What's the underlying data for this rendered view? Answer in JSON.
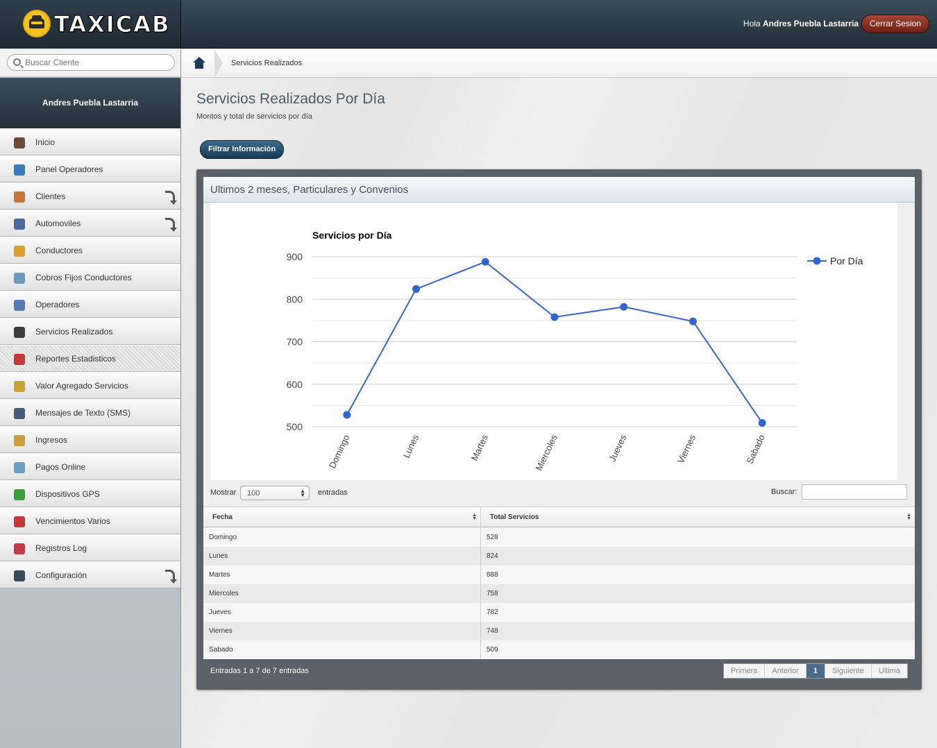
{
  "header": {
    "logo_text": "TAXICAB",
    "greeting_prefix": "Hola",
    "user_name": "Andres Puebla Lastarria",
    "logout_label": "Cerrar Sesion"
  },
  "sidebar": {
    "search_placeholder": "Buscar Cliente",
    "user_name": "Andres Puebla Lastarria",
    "items": [
      {
        "label": "Inicio",
        "icon": "speedometer-icon",
        "color": "#6a4b3a",
        "submenu": false
      },
      {
        "label": "Panel Operadores",
        "icon": "monitor-icon",
        "color": "#3a7ab8",
        "submenu": false
      },
      {
        "label": "Clientes",
        "icon": "users-icon",
        "color": "#c8763a",
        "submenu": true
      },
      {
        "label": "Automoviles",
        "icon": "car-icon",
        "color": "#4a6a9a",
        "submenu": true
      },
      {
        "label": "Conductores",
        "icon": "driver-icon",
        "color": "#d8a030",
        "submenu": false
      },
      {
        "label": "Cobros Fijos Conductores",
        "icon": "ledger-icon",
        "color": "#6a9ac0",
        "submenu": false
      },
      {
        "label": "Operadores",
        "icon": "operator-icon",
        "color": "#5a7ab0",
        "submenu": false
      },
      {
        "label": "Servicios Realizados",
        "icon": "road-icon",
        "color": "#3a3a3a",
        "submenu": false
      },
      {
        "label": "Reportes Estadisticos",
        "icon": "bar-chart-icon",
        "color": "#c03a3a",
        "submenu": false
      },
      {
        "label": "Valor Agregado Servicios",
        "icon": "coins-icon",
        "color": "#c8a040",
        "submenu": false
      },
      {
        "label": "Mensajes de Texto (SMS)",
        "icon": "phone-icon",
        "color": "#4a5a7a",
        "submenu": false
      },
      {
        "label": "Ingresos",
        "icon": "money-icon",
        "color": "#c8a040",
        "submenu": false
      },
      {
        "label": "Pagos Online",
        "icon": "payment-icon",
        "color": "#6aa0c0",
        "submenu": false
      },
      {
        "label": "Dispositivos GPS",
        "icon": "gps-icon",
        "color": "#3aa03a",
        "submenu": false
      },
      {
        "label": "Vencimientos Varios",
        "icon": "calendar-icon",
        "color": "#c03a3a",
        "submenu": false
      },
      {
        "label": "Registros Log",
        "icon": "log-icon",
        "color": "#c03a4a",
        "submenu": false
      },
      {
        "label": "Configuración",
        "icon": "settings-icon",
        "color": "#3a4a5a",
        "submenu": true
      }
    ],
    "active_index": 8
  },
  "breadcrumb": {
    "current": "Servicios Realizados"
  },
  "page": {
    "title": "Servicios Realizados Por Día",
    "subtitle": "Montos y total de servicios por día",
    "filter_button": "Filtrar Información"
  },
  "panel": {
    "title": "Ultimos 2 meses, Particulares y Convenios"
  },
  "chart_data": {
    "type": "line",
    "title": "Servicios por Día",
    "categories": [
      "Domingo",
      "Lunes",
      "Martes",
      "Miercoles",
      "Jueves",
      "Viernes",
      "Sabado"
    ],
    "series": [
      {
        "name": "Por Día",
        "values": [
          528,
          824,
          888,
          758,
          782,
          748,
          509
        ],
        "color": "#3366cc"
      }
    ],
    "yticks": [
      500,
      600,
      700,
      800,
      900
    ],
    "ylim": [
      500,
      900
    ],
    "grid": true,
    "legend": "right"
  },
  "table": {
    "show_label": "Mostrar",
    "page_size": "100",
    "entries_label": "entradas",
    "search_label": "Buscar:",
    "columns": [
      "Fecha",
      "Total Servicios"
    ],
    "rows": [
      [
        "Domingo",
        "528"
      ],
      [
        "Lunes",
        "824"
      ],
      [
        "Martes",
        "888"
      ],
      [
        "Miercoles",
        "758"
      ],
      [
        "Jueves",
        "782"
      ],
      [
        "Viernes",
        "748"
      ],
      [
        "Sabado",
        "509"
      ]
    ],
    "info": "Entradas 1 a 7 de 7 entradas",
    "pager": {
      "first": "Primera",
      "prev": "Anterior",
      "current": "1",
      "next": "Siguiente",
      "last": "Ultima"
    }
  }
}
